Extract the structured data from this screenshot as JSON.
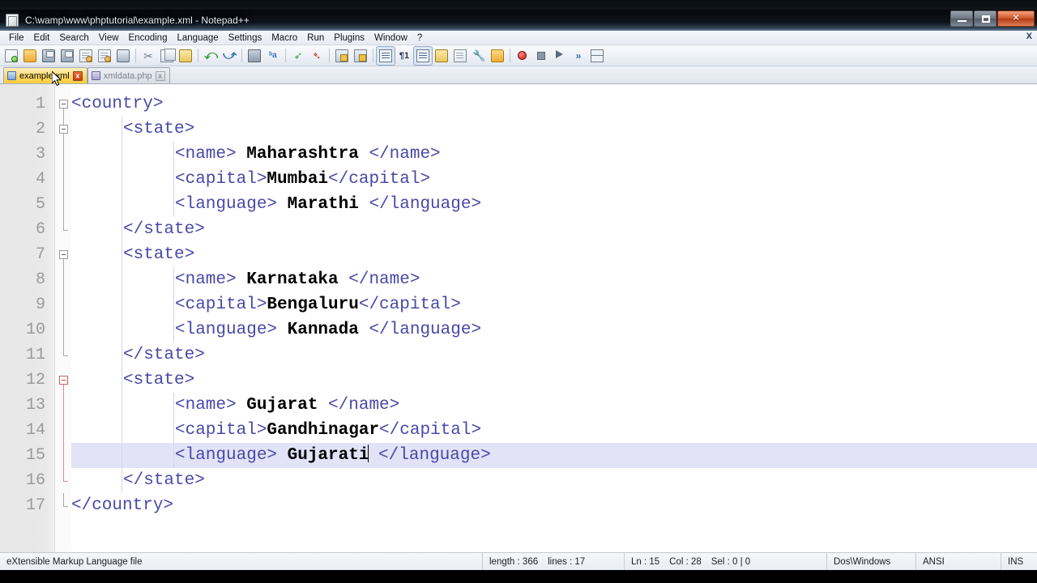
{
  "window": {
    "title": "C:\\wamp\\www\\phptutorial\\example.xml - Notepad++",
    "app_icon": "notepad-plus-plus-icon",
    "minimize_label": "Minimize",
    "restore_label": "Restore",
    "close_label": "Close"
  },
  "menubar": {
    "items": [
      {
        "label": "File"
      },
      {
        "label": "Edit"
      },
      {
        "label": "Search"
      },
      {
        "label": "View"
      },
      {
        "label": "Encoding"
      },
      {
        "label": "Language"
      },
      {
        "label": "Settings"
      },
      {
        "label": "Macro"
      },
      {
        "label": "Run"
      },
      {
        "label": "Plugins"
      },
      {
        "label": "Window"
      },
      {
        "label": "?"
      }
    ],
    "document_close": "X"
  },
  "toolbar": {
    "buttons": [
      {
        "name": "new-file-icon"
      },
      {
        "name": "open-file-icon"
      },
      {
        "name": "save-icon"
      },
      {
        "name": "save-all-icon"
      },
      {
        "name": "close-file-icon"
      },
      {
        "name": "close-all-files-icon"
      },
      {
        "name": "print-icon"
      },
      {
        "name": "cut-icon"
      },
      {
        "name": "copy-icon"
      },
      {
        "name": "paste-icon"
      },
      {
        "name": "undo-icon"
      },
      {
        "name": "redo-icon"
      },
      {
        "name": "find-icon"
      },
      {
        "name": "replace-icon"
      },
      {
        "name": "zoom-in-icon"
      },
      {
        "name": "zoom-out-icon"
      },
      {
        "name": "sync-vertical-scroll-icon"
      },
      {
        "name": "sync-horizontal-scroll-icon"
      },
      {
        "name": "word-wrap-icon"
      },
      {
        "name": "show-all-characters-icon"
      },
      {
        "name": "indent-guideline-icon"
      },
      {
        "name": "user-defined-language-icon"
      },
      {
        "name": "document-map-icon"
      },
      {
        "name": "function-list-icon"
      },
      {
        "name": "folder-as-workspace-icon"
      },
      {
        "name": "start-record-macro-icon"
      },
      {
        "name": "stop-record-macro-icon"
      },
      {
        "name": "playback-macro-icon"
      },
      {
        "name": "run-macro-multiple-icon"
      },
      {
        "name": "run-icon"
      }
    ]
  },
  "tabs": [
    {
      "label": "example.xml",
      "icon": "xml-file-icon",
      "active": true,
      "close": "x"
    },
    {
      "label": "xmldata.php",
      "icon": "php-file-icon",
      "active": false,
      "close": "x"
    }
  ],
  "editor": {
    "language": "XML",
    "active_line": 15,
    "caret_after": "Gujarati",
    "lines": [
      {
        "n": "1",
        "indent": 0,
        "fold": "open",
        "parts": [
          {
            "t": "tag",
            "s": "<country>"
          }
        ]
      },
      {
        "n": "2",
        "indent": 1,
        "fold": "open",
        "parts": [
          {
            "t": "tag",
            "s": "<state>"
          }
        ]
      },
      {
        "n": "3",
        "indent": 2,
        "fold": "none",
        "parts": [
          {
            "t": "tag",
            "s": "<name> "
          },
          {
            "t": "val",
            "s": "Maharashtra"
          },
          {
            "t": "tag",
            "s": " </name>"
          }
        ]
      },
      {
        "n": "4",
        "indent": 2,
        "fold": "none",
        "parts": [
          {
            "t": "tag",
            "s": "<capital>"
          },
          {
            "t": "val",
            "s": "Mumbai"
          },
          {
            "t": "tag",
            "s": "</capital>"
          }
        ]
      },
      {
        "n": "5",
        "indent": 2,
        "fold": "none",
        "parts": [
          {
            "t": "tag",
            "s": "<language> "
          },
          {
            "t": "val",
            "s": "Marathi"
          },
          {
            "t": "tag",
            "s": " </language>"
          }
        ]
      },
      {
        "n": "6",
        "indent": 1,
        "fold": "end",
        "parts": [
          {
            "t": "tag",
            "s": "</state>"
          }
        ]
      },
      {
        "n": "7",
        "indent": 1,
        "fold": "open",
        "parts": [
          {
            "t": "tag",
            "s": "<state>"
          }
        ]
      },
      {
        "n": "8",
        "indent": 2,
        "fold": "none",
        "parts": [
          {
            "t": "tag",
            "s": "<name> "
          },
          {
            "t": "val",
            "s": "Karnataka"
          },
          {
            "t": "tag",
            "s": " </name>"
          }
        ]
      },
      {
        "n": "9",
        "indent": 2,
        "fold": "none",
        "parts": [
          {
            "t": "tag",
            "s": "<capital>"
          },
          {
            "t": "val",
            "s": "Bengaluru"
          },
          {
            "t": "tag",
            "s": "</capital>"
          }
        ]
      },
      {
        "n": "10",
        "indent": 2,
        "fold": "none",
        "parts": [
          {
            "t": "tag",
            "s": "<language> "
          },
          {
            "t": "val",
            "s": "Kannada"
          },
          {
            "t": "tag",
            "s": " </language>"
          }
        ]
      },
      {
        "n": "11",
        "indent": 1,
        "fold": "end",
        "parts": [
          {
            "t": "tag",
            "s": "</state>"
          }
        ]
      },
      {
        "n": "12",
        "indent": 1,
        "fold": "open-red",
        "parts": [
          {
            "t": "tag",
            "s": "<state>"
          }
        ]
      },
      {
        "n": "13",
        "indent": 2,
        "fold": "red",
        "parts": [
          {
            "t": "tag",
            "s": "<name> "
          },
          {
            "t": "val",
            "s": "Gujarat"
          },
          {
            "t": "tag",
            "s": " </name>"
          }
        ]
      },
      {
        "n": "14",
        "indent": 2,
        "fold": "red",
        "parts": [
          {
            "t": "tag",
            "s": "<capital>"
          },
          {
            "t": "val",
            "s": "Gandhinagar"
          },
          {
            "t": "tag",
            "s": "</capital>"
          }
        ]
      },
      {
        "n": "15",
        "indent": 2,
        "fold": "red",
        "highlight": true,
        "caret_at": 2,
        "parts": [
          {
            "t": "tag",
            "s": "<language> "
          },
          {
            "t": "val",
            "s": "Gujarati"
          },
          {
            "t": "caret",
            "s": ""
          },
          {
            "t": "tag",
            "s": " </language>"
          }
        ]
      },
      {
        "n": "16",
        "indent": 1,
        "fold": "end-red",
        "parts": [
          {
            "t": "tag",
            "s": "</state>"
          }
        ]
      },
      {
        "n": "17",
        "indent": 0,
        "fold": "end",
        "parts": [
          {
            "t": "tag",
            "s": "</country>"
          }
        ]
      }
    ]
  },
  "statusbar": {
    "file_type": "eXtensible Markup Language file",
    "length": "length : 366",
    "lines": "lines : 17",
    "ln": "Ln : 15",
    "col": "Col : 28",
    "sel": "Sel : 0 | 0",
    "eol": "Dos\\Windows",
    "encoding": "ANSI",
    "insert_mode": "INS"
  },
  "colors": {
    "tag": "#4848a8",
    "value": "#000000",
    "active_line_highlight": "#e2e3f7",
    "active_tab": "#ffcc3d",
    "gutter": "#e7e7e7",
    "fold_current": "#d06060"
  }
}
